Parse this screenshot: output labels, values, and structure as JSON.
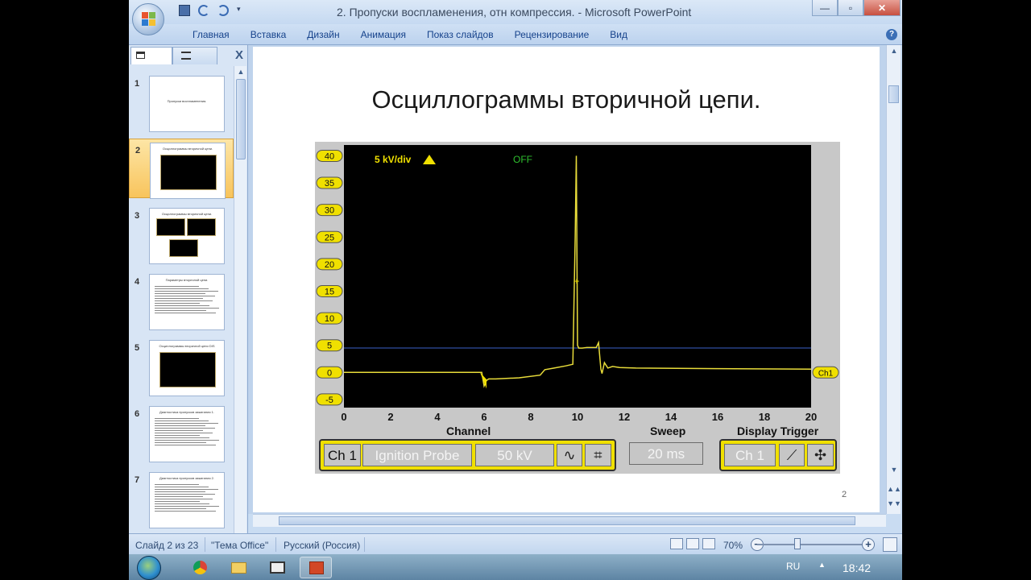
{
  "window": {
    "title": "2. Пропуски воспламенения, отн компрессия. - Microsoft PowerPoint",
    "minimize": "—",
    "maximize": "▫",
    "close": "✕"
  },
  "ribbon": {
    "tabs": [
      "Главная",
      "Вставка",
      "Дизайн",
      "Анимация",
      "Показ слайдов",
      "Рецензирование",
      "Вид"
    ],
    "help": "?"
  },
  "leftpane": {
    "close": "X",
    "slides": [
      {
        "num": "1",
        "title": "Пропуски воспламенения."
      },
      {
        "num": "2",
        "title": "Осциллограммы вторичной цепи."
      },
      {
        "num": "3",
        "title": "Осциллограммы вторичной цепи."
      },
      {
        "num": "4",
        "title": "Параметры вторичной цепи."
      },
      {
        "num": "5",
        "title": "Осциллограммы вторичной цепи DIS"
      },
      {
        "num": "6",
        "title": "Диагностика пропусков зажигания 1."
      },
      {
        "num": "7",
        "title": "Диагностика пропусков зажигания 2."
      }
    ]
  },
  "slide": {
    "title": "Осциллограммы вторичной цепи.",
    "number": "2"
  },
  "scope": {
    "scale_label": "5 kV/div",
    "off_label": "OFF",
    "channel_marker": "Ch1",
    "channel_title": "Channel",
    "sweep_title": "Sweep",
    "trigger_title": "Display Trigger",
    "channel_buttons": {
      "ch": "Ch 1",
      "probe": "Ignition Probe",
      "range": "50 kV"
    },
    "sweep_button": "20 ms",
    "trigger_button": "Ch 1"
  },
  "chart_data": {
    "type": "line",
    "xlabel": "",
    "ylabel": "",
    "x_ticks": [
      0,
      2,
      4,
      6,
      8,
      10,
      12,
      14,
      16,
      18,
      20
    ],
    "y_ticks": [
      40,
      35,
      30,
      25,
      20,
      15,
      10,
      5,
      0,
      -5
    ],
    "xlim": [
      0,
      20
    ],
    "ylim": [
      -6.5,
      42
    ],
    "trigger_level": 4.5,
    "series": [
      {
        "x": [
          0,
          5.9,
          6.0,
          6.1,
          6.2,
          6.5,
          7.5,
          8.4,
          8.6,
          9.0,
          9.5,
          9.8,
          9.9,
          9.95,
          10.0,
          10.05,
          10.1,
          10.2,
          10.4,
          10.8,
          10.9,
          11.0,
          11.05,
          11.15,
          11.3,
          11.5,
          11.8,
          12.5,
          16,
          20
        ],
        "y": [
          0,
          0,
          -2.5,
          -1.5,
          -1.2,
          -1.2,
          -1.0,
          -0.5,
          0.5,
          0.8,
          1.2,
          1.5,
          25,
          40,
          5,
          4.5,
          4.5,
          4.5,
          4.6,
          4.6,
          5.5,
          0.6,
          -0.2,
          1.8,
          0.8,
          1.1,
          0.9,
          0.8,
          0.7,
          0.6
        ]
      }
    ]
  },
  "statusbar": {
    "slide_info": "Слайд 2 из 23",
    "theme": "\"Тема Office\"",
    "language": "Русский (Россия)",
    "zoom": "70%"
  },
  "taskbar": {
    "lang": "RU",
    "time": "18:42"
  }
}
